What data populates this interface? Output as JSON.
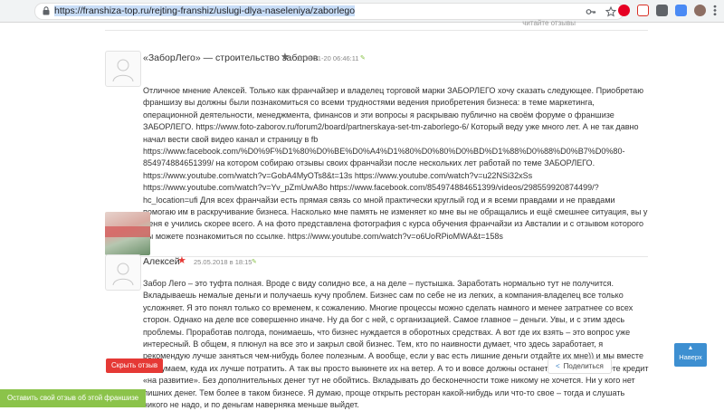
{
  "browser": {
    "url": "https://franshiza-top.ru/rejting-franshiz/uslugi-dlya-naseleniya/zaborlego"
  },
  "top_strip": {
    "ghost_text": "читайте отзывы"
  },
  "reviews": [
    {
      "author": "«ЗаборЛего» — строительство заборов",
      "date": "2018-11-20 06:46:11",
      "text": "Отличное мнение Алексей. Только как франчайзер и владелец торговой марки ЗАБОРЛЕГО хочу сказать следующее. Приобретаю франшизу вы должны были познакомиться со всеми трудностями ведения приобретения бизнеса: в теме маркетинга, операционной деятельности, менеджмента, финансов и эти вопросы я раскрываю публично на своём форуме о франшизе ЗАБОРЛЕГО. https://www.foto-zaborov.ru/forum2/board/partnerskaya-set-tm-zaborlego-6/ Который веду уже много лет. А не так давно начал вести свой видео канал и страницу в fb https://www.facebook.com/%D0%9F%D1%80%D0%BE%D0%A4%D1%80%D0%80%D0%BD%D1%88%D0%88%D0%B7%D0%80-854974884651399/ на котором собираю отзывы своих франчайзи после нескольких лет работай по теме ЗАБОРЛЕГО. https://www.youtube.com/watch?v=GobA4MyOTs8&t=13s https://www.youtube.com/watch?v=u22NSi32xSs https://www.youtube.com/watch?v=Yv_pZmUwA8o https://www.facebook.com/854974884651399/videos/298559920874499/?hc_location=ufi Для всех франчайзи есть прямая связь со мной практически круглый год и я всеми правдами и не правдами помогаю им в раскручивание бизнеса. Насколько мне память не изменяет ко мне вы не обращались и ещё смешнее ситуация, вы у меня е учились скорее всего. А на фото представлена фотография с курса обучения франчайзи из Австалии и с отзывом которого вы можете познакомиться по ссылке. https://www.youtube.com/watch?v=o6UoRPioMWA&t=158s"
    },
    {
      "author": "Алексей",
      "date": "25.05.2018 в 18:15",
      "text": "Забор Лего – это туфта полная. Вроде с виду солидно все, а на деле – пустышка. Заработать нормально тут не получится. Вкладываешь немалые деньги и получаешь кучу проблем. Бизнес сам по себе не из легких, а компания-владелец все только усложняет. Я это понял только со временем, к сожалению. Многие процессы можно сделать намного и менее затратнее со всех сторон. Однако на деле все совершенно иначе. Ну да бог с ней, с организацией. Самое главное – деньги. Увы, и с этим здесь проблемы. Проработав полгода, понимаешь, что бизнес нуждается в оборотных средствах. А вот где их взять – это вопрос уже интересный. В общем, я плюнул на все это и закрыл свой бизнес. Тем, кто по наивности думает, что здесь заработает, я рекомендую лучше заняться чем-нибудь более полезным. А вообще, если у вас есть лишние деньги отдайте их мне)) и мы вместе придумаем, куда их лучше потратить. А так вы просто выкинете их на ветер. А то и вовсе должны останетесь, если возьмете кредит «на развитие». Без дополнительных денег тут не обойтись. Вкладывать до бесконечности тоже никому не хочется. Ни у кого нет лишних денег. Тем более в таком бизнесе. Я думаю, проще открыть ресторан какой-нибудь или что-то свое – тогда и слушать никого не надо, и по деньгам наверняка меньше выйдет."
    }
  ],
  "buttons": {
    "hide": "Скрыть отзыв",
    "share": "Поделиться",
    "leave_review": "Оставить свой отзыв об этой франшизе",
    "scroll_up": "Наверх"
  },
  "colors": {
    "accent_green": "#8bc34a",
    "accent_red": "#e53935",
    "accent_blue": "#3d8fd1"
  }
}
